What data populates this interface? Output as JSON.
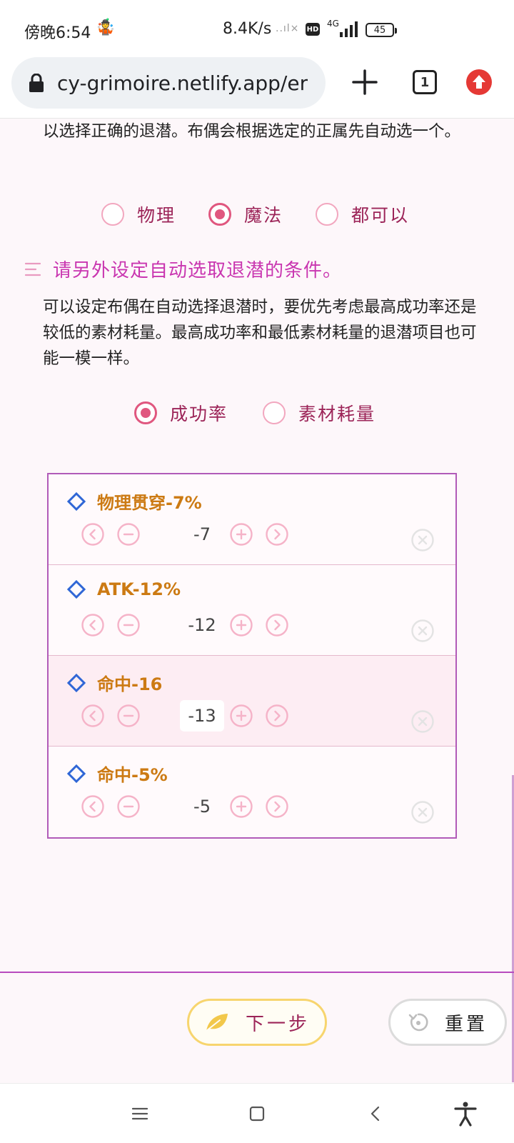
{
  "status_bar": {
    "time": "傍晚6:54",
    "emoji": "🤹",
    "net_speed": "8.4K/s",
    "network": "4G",
    "hd": "HD",
    "battery": "45"
  },
  "browser": {
    "url": "cy-grimoire.netlify.app/er",
    "tab_count": "1"
  },
  "intro_paragraph": "以选择正确的退潜。布偶会根据选定的正属先自动选一个。",
  "attack_type": {
    "options": [
      "物理",
      "魔法",
      "都可以"
    ],
    "selected": "魔法"
  },
  "criteria_section": {
    "heading": "请另外设定自动选取退潜的条件。",
    "description": "可以设定布偶在自动选择退潜时，要优先考虑最高成功率还是较低的素材耗量。最高成功率和最低素材耗量的退潜项目也可能一模一样。",
    "options": [
      "成功率",
      "素材耗量"
    ],
    "selected": "成功率"
  },
  "stat_items": [
    {
      "title": "物理贯穿-7%",
      "value": "-7"
    },
    {
      "title": "ATK-12%",
      "value": "-12"
    },
    {
      "title": "命中-16",
      "value": "-13"
    },
    {
      "title": "命中-5%",
      "value": "-5"
    }
  ],
  "actions": {
    "next_label": "下一步",
    "reset_label": "重置"
  },
  "colors": {
    "accent_pink": "#e0577f",
    "title_orange": "#cc7a13",
    "heading_magenta": "#c936b0",
    "list_border": "#b15bb8"
  }
}
